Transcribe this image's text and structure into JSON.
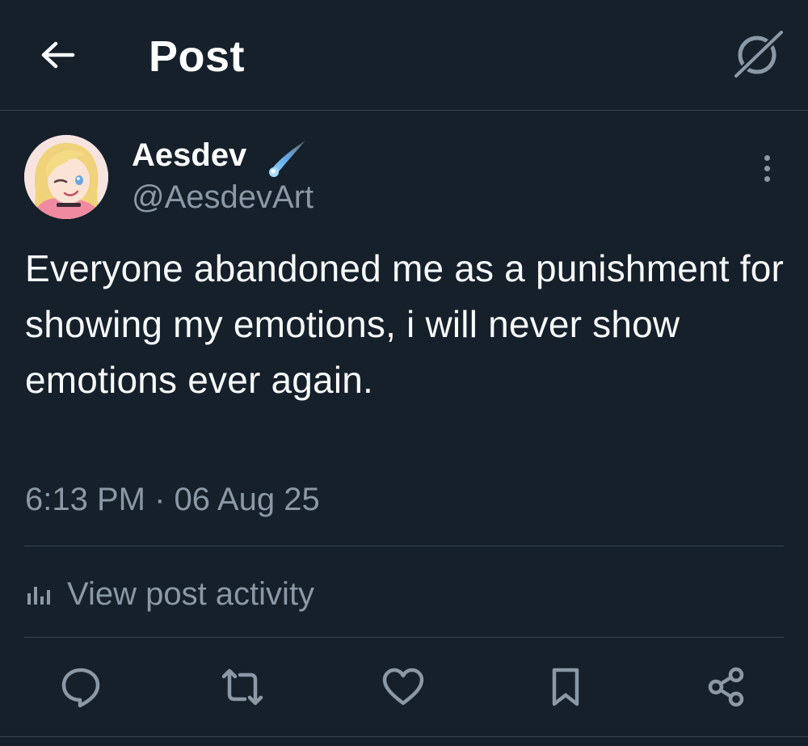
{
  "header": {
    "title": "Post",
    "back_icon": "arrow-left-icon",
    "grok_icon": "grok-icon"
  },
  "author": {
    "display_name": "Aesdev",
    "handle": "@AesdevArt",
    "badge_icon": "comet-icon"
  },
  "post": {
    "text": "Everyone abandoned me as a punishment for showing my emotions, i will never show emotions ever again.",
    "timestamp": "6:13 PM · 06 Aug 25"
  },
  "activity": {
    "label": "View post activity",
    "icon": "analytics-bars-icon"
  },
  "actions": [
    "reply-icon",
    "repost-icon",
    "like-icon",
    "bookmark-icon",
    "share-icon"
  ],
  "colors": {
    "background": "#15202b",
    "secondary_text": "#8b98a5",
    "divider": "#38444d",
    "icon": "#8b98a5"
  }
}
